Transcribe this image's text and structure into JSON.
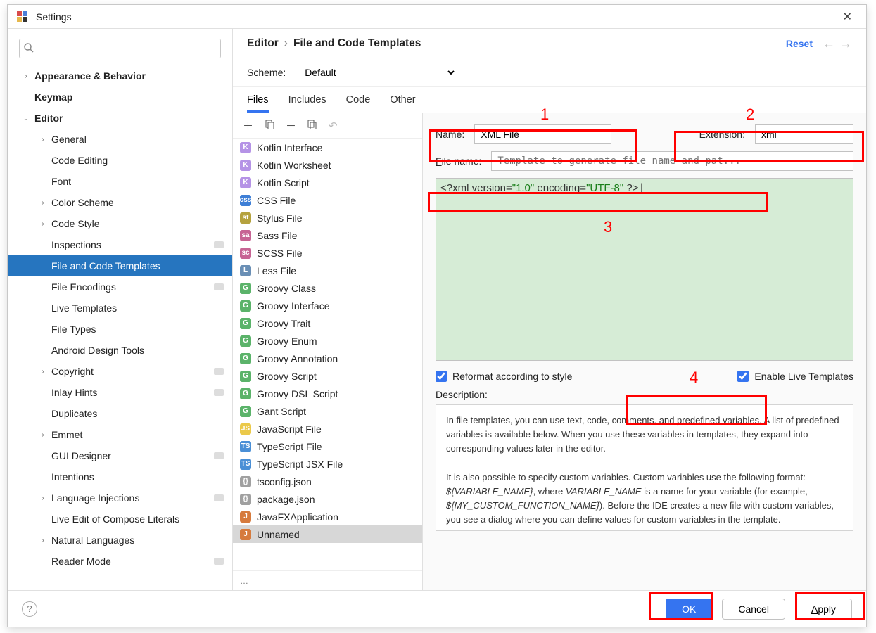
{
  "title": "Settings",
  "breadcrumb": {
    "root": "Editor",
    "leaf": "File and Code Templates",
    "reset": "Reset"
  },
  "scheme": {
    "label": "Scheme:",
    "value": "Default"
  },
  "tabs": [
    "Files",
    "Includes",
    "Code",
    "Other"
  ],
  "activeTab": 0,
  "sidebar": {
    "items": [
      {
        "label": "Appearance & Behavior",
        "level": 0,
        "bold": true,
        "chev": "›"
      },
      {
        "label": "Keymap",
        "level": 0,
        "bold": true
      },
      {
        "label": "Editor",
        "level": 0,
        "bold": true,
        "chev": "⌄"
      },
      {
        "label": "General",
        "level": 1,
        "chev": "›"
      },
      {
        "label": "Code Editing",
        "level": 1
      },
      {
        "label": "Font",
        "level": 1
      },
      {
        "label": "Color Scheme",
        "level": 1,
        "chev": "›"
      },
      {
        "label": "Code Style",
        "level": 1,
        "chev": "›"
      },
      {
        "label": "Inspections",
        "level": 1,
        "badge": true
      },
      {
        "label": "File and Code Templates",
        "level": 1,
        "selected": true
      },
      {
        "label": "File Encodings",
        "level": 1,
        "badge": true
      },
      {
        "label": "Live Templates",
        "level": 1
      },
      {
        "label": "File Types",
        "level": 1
      },
      {
        "label": "Android Design Tools",
        "level": 1
      },
      {
        "label": "Copyright",
        "level": 1,
        "chev": "›",
        "badge": true
      },
      {
        "label": "Inlay Hints",
        "level": 1,
        "badge": true
      },
      {
        "label": "Duplicates",
        "level": 1
      },
      {
        "label": "Emmet",
        "level": 1,
        "chev": "›"
      },
      {
        "label": "GUI Designer",
        "level": 1,
        "badge": true
      },
      {
        "label": "Intentions",
        "level": 1
      },
      {
        "label": "Language Injections",
        "level": 1,
        "chev": "›",
        "badge": true
      },
      {
        "label": "Live Edit of Compose Literals",
        "level": 1
      },
      {
        "label": "Natural Languages",
        "level": 1,
        "chev": "›"
      },
      {
        "label": "Reader Mode",
        "level": 1,
        "badge": true
      }
    ]
  },
  "fileList": [
    {
      "label": "Kotlin Interface",
      "ic": "ic-k",
      "t": "K"
    },
    {
      "label": "Kotlin Worksheet",
      "ic": "ic-k",
      "t": "K"
    },
    {
      "label": "Kotlin Script",
      "ic": "ic-k",
      "t": "K"
    },
    {
      "label": "CSS File",
      "ic": "ic-css",
      "t": "css"
    },
    {
      "label": "Stylus File",
      "ic": "ic-styl",
      "t": "st"
    },
    {
      "label": "Sass File",
      "ic": "ic-sass",
      "t": "sa"
    },
    {
      "label": "SCSS File",
      "ic": "ic-scss",
      "t": "sc"
    },
    {
      "label": "Less File",
      "ic": "ic-less",
      "t": "L"
    },
    {
      "label": "Groovy Class",
      "ic": "ic-g",
      "t": "G"
    },
    {
      "label": "Groovy Interface",
      "ic": "ic-g",
      "t": "G"
    },
    {
      "label": "Groovy Trait",
      "ic": "ic-g",
      "t": "G"
    },
    {
      "label": "Groovy Enum",
      "ic": "ic-g",
      "t": "G"
    },
    {
      "label": "Groovy Annotation",
      "ic": "ic-g",
      "t": "G"
    },
    {
      "label": "Groovy Script",
      "ic": "ic-g",
      "t": "G"
    },
    {
      "label": "Groovy DSL Script",
      "ic": "ic-g",
      "t": "G"
    },
    {
      "label": "Gant Script",
      "ic": "ic-g",
      "t": "G"
    },
    {
      "label": "JavaScript File",
      "ic": "ic-js",
      "t": "JS"
    },
    {
      "label": "TypeScript File",
      "ic": "ic-ts",
      "t": "TS"
    },
    {
      "label": "TypeScript JSX File",
      "ic": "ic-ts",
      "t": "TS"
    },
    {
      "label": "tsconfig.json",
      "ic": "ic-json",
      "t": "{}"
    },
    {
      "label": "package.json",
      "ic": "ic-json",
      "t": "{}"
    },
    {
      "label": "JavaFXApplication",
      "ic": "ic-fx",
      "t": "J"
    },
    {
      "label": "Unnamed",
      "ic": "ic-fx",
      "t": "J",
      "selected": true
    }
  ],
  "form": {
    "nameLabel": "Name:",
    "nameValue": "XML File",
    "extLabel": "Extension:",
    "extValue": "xml",
    "fileNameLabel": "File name:",
    "fileNamePlaceholder": "Template to generate file name and pat...",
    "codePrefix": "<?xml version=",
    "codeStr1": "\"1.0\"",
    "codeMid": " encoding=",
    "codeStr2": "\"UTF-8\"",
    "codeSuffix": " ?>",
    "reformat": "Reformat according to style",
    "liveTemplates": "Enable Live Templates",
    "descLabel": "Description:",
    "desc1": "In file templates, you can use text, code, comments, and predefined variables. A list of predefined variables is available below. When you use these variables in templates, they expand into corresponding values later in the editor.",
    "desc2a": "It is also possible to specify custom variables. Custom variables use the following format: ",
    "desc2b": "${VARIABLE_NAME}",
    "desc2c": ", where ",
    "desc2d": "VARIABLE_NAME",
    "desc2e": " is a name for your variable (for example, ",
    "desc2f": "${MY_CUSTOM_FUNCTION_NAME}",
    "desc2g": "). Before the IDE creates a new file with custom variables, you see a dialog where you can define values for custom variables in the template."
  },
  "footer": {
    "ok": "OK",
    "cancel": "Cancel",
    "apply": "Apply"
  },
  "annots": {
    "n1": "1",
    "n2": "2",
    "n3": "3",
    "n4": "4"
  }
}
